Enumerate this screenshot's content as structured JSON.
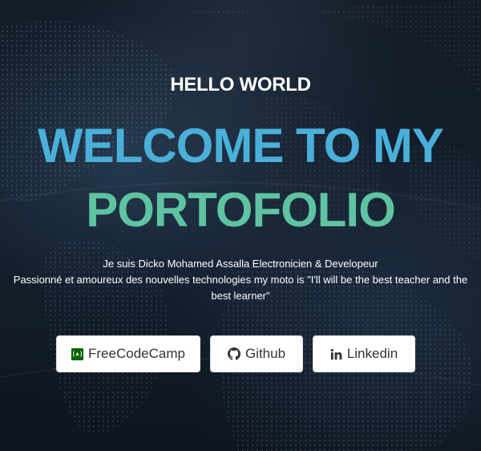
{
  "hero": {
    "greeting": "HELLO WORLD",
    "title_line1": "WELCOME TO MY",
    "title_line2": "PORTOFOLIO",
    "intro_line1": "Je suis Dicko Mohamed Assalla Electronicien & Developeur",
    "intro_line2": "Passionné et amoureux des nouvelles technologies my moto is \"I'll will be the best teacher and the best learner\""
  },
  "buttons": {
    "freecodecamp": {
      "label": "FreeCodeCamp",
      "icon": "freecodecamp-icon"
    },
    "github": {
      "label": "Github",
      "icon": "github-icon"
    },
    "linkedin": {
      "label": "Linkedin",
      "icon": "linkedin-icon"
    }
  },
  "colors": {
    "title_line1": "#4aafd9",
    "title_line2": "#5fc3a2",
    "freecodecamp_green": "#006400"
  }
}
